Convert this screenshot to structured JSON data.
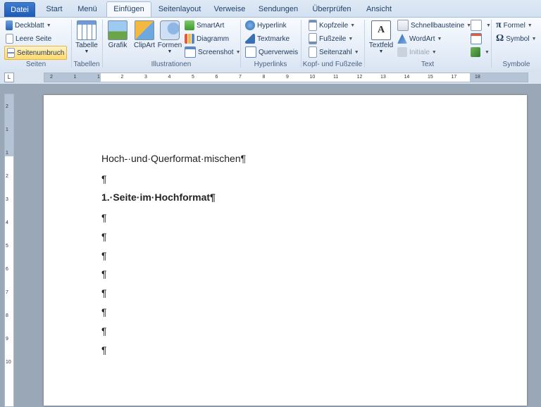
{
  "tabs": [
    "Datei",
    "Start",
    "Menü",
    "Einfügen",
    "Seitenlayout",
    "Verweise",
    "Sendungen",
    "Überprüfen",
    "Ansicht"
  ],
  "active_tab": "Einfügen",
  "ribbon": {
    "seiten": {
      "label": "Seiten",
      "deckblatt": "Deckblatt",
      "leere_seite": "Leere Seite",
      "seitenumbruch": "Seitenumbruch"
    },
    "tabellen": {
      "label": "Tabellen",
      "tabelle": "Tabelle"
    },
    "illustrationen": {
      "label": "Illustrationen",
      "grafik": "Grafik",
      "clipart": "ClipArt",
      "formen": "Formen",
      "smartart": "SmartArt",
      "diagramm": "Diagramm",
      "screenshot": "Screenshot"
    },
    "hyperlinks": {
      "label": "Hyperlinks",
      "hyperlink": "Hyperlink",
      "textmarke": "Textmarke",
      "querverweis": "Querverweis"
    },
    "kopf_fuss": {
      "label": "Kopf- und Fußzeile",
      "kopfzeile": "Kopfzeile",
      "fusszeile": "Fußzeile",
      "seitenzahl": "Seitenzahl"
    },
    "text": {
      "label": "Text",
      "textfeld": "Textfeld",
      "schnellbausteine": "Schnellbausteine",
      "wordart": "WordArt",
      "initiale": "Initiale"
    },
    "symbole": {
      "label": "Symbole",
      "formel": "Formel",
      "symbol": "Symbol"
    }
  },
  "ruler": {
    "tab_selector": "L",
    "numbers": [
      "2",
      "1",
      "1",
      "2",
      "3",
      "4",
      "5",
      "6",
      "7",
      "8",
      "9",
      "10",
      "11",
      "12",
      "13",
      "14",
      "15",
      "17",
      "18"
    ],
    "vnumbers": [
      "2",
      "1",
      "1",
      "2",
      "3",
      "4",
      "5",
      "6",
      "7",
      "8",
      "9",
      "10"
    ]
  },
  "document": {
    "lines": [
      "Hoch-·und·Querformat·mischen¶",
      "¶",
      "1.·Seite·im·Hochformat¶",
      "¶",
      "¶",
      "¶",
      "¶",
      "¶",
      "¶",
      "¶",
      "¶"
    ]
  },
  "colors": {
    "accent": "#2b579a",
    "ribbon_bg": "#e4ecf7",
    "highlight": "#ffd96b"
  }
}
